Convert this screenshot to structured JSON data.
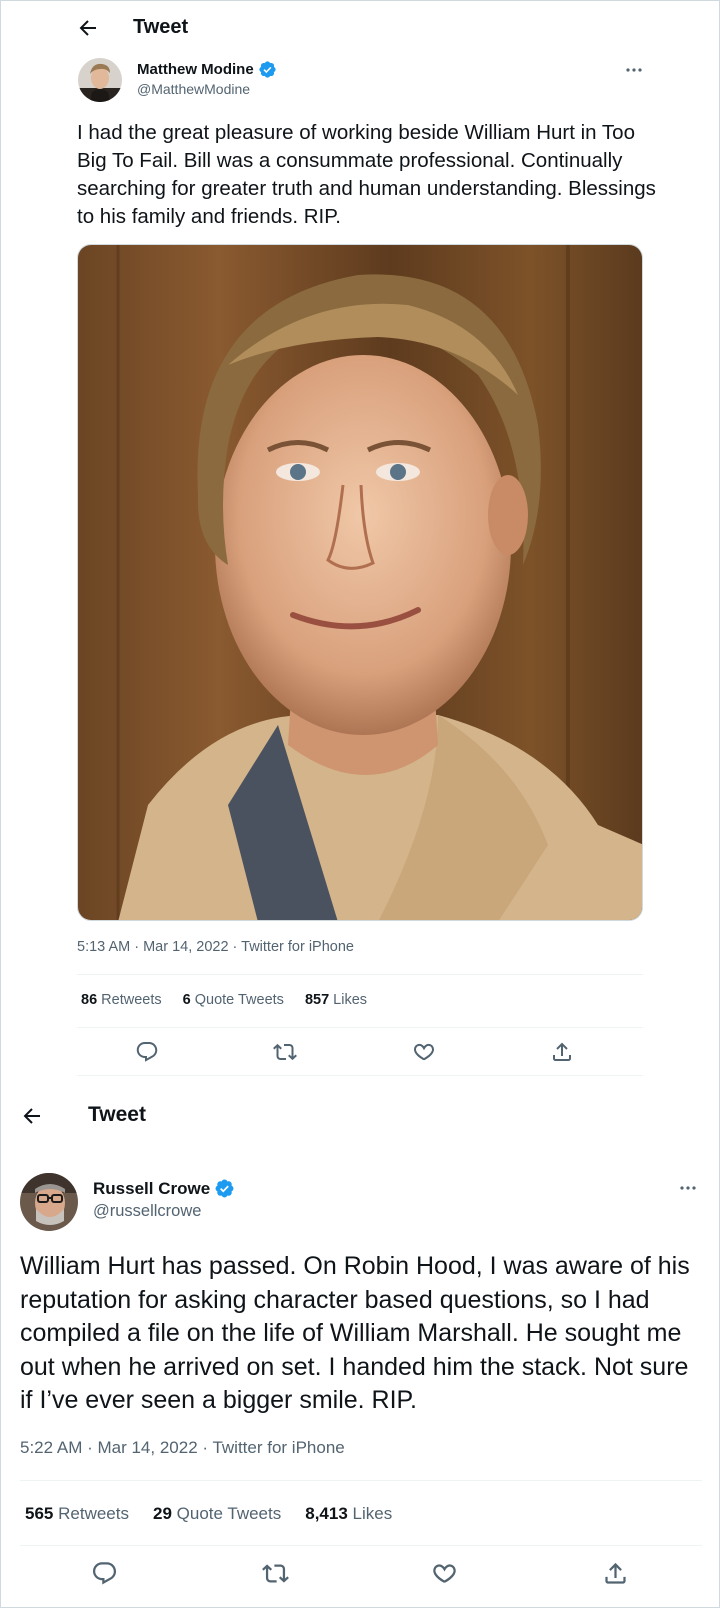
{
  "tweets": [
    {
      "header_title": "Tweet",
      "author": {
        "name": "Matthew Modine",
        "handle": "@MatthewModine",
        "verified": true
      },
      "text": "I had the great pleasure of working beside William Hurt in Too Big To Fail. Bill was a consummate professional. Continually searching for greater truth and human understanding. Blessings to his family and friends. RIP.",
      "timestamp": "5:13 AM · Mar 14, 2022 · Twitter for iPhone",
      "stats": {
        "retweets": "86",
        "retweets_label": "Retweets",
        "quotes": "6",
        "quotes_label": "Quote Tweets",
        "likes": "857",
        "likes_label": "Likes"
      },
      "media": {
        "description_icon": "portrait-photo"
      }
    },
    {
      "header_title": "Tweet",
      "author": {
        "name": "Russell Crowe",
        "handle": "@russellcrowe",
        "verified": true
      },
      "text": "William Hurt has passed. On Robin Hood, I was aware of his reputation for asking character based questions, so I had compiled a file on the life of William Marshall. He sought me out when he arrived on set. I handed him the stack. Not sure if I’ve ever seen a bigger smile. RIP.",
      "timestamp": "5:22 AM · Mar 14, 2022 · Twitter for iPhone",
      "stats": {
        "retweets": "565",
        "retweets_label": "Retweets",
        "quotes": "29",
        "quotes_label": "Quote Tweets",
        "likes": "8,413",
        "likes_label": "Likes"
      }
    }
  ],
  "icons": {
    "back": "arrow-left-icon",
    "more": "more-horizontal-icon",
    "verified": "verified-badge-icon",
    "reply": "reply-icon",
    "retweet": "retweet-icon",
    "like": "like-icon",
    "share": "share-icon"
  },
  "colors": {
    "verified": "#1d9bf0",
    "text": "#0f1419",
    "secondary": "#536471",
    "divider": "#eff3f4"
  }
}
